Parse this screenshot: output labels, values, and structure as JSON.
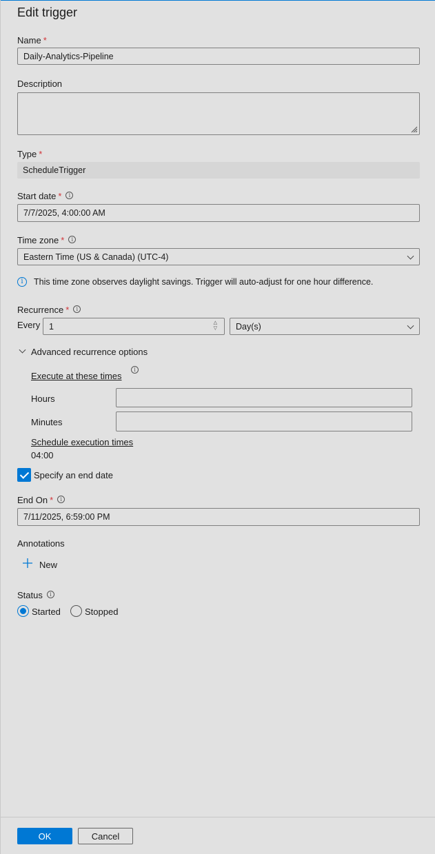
{
  "title": "Edit trigger",
  "name": {
    "label": "Name",
    "required": "*",
    "value": "Daily-Analytics-Pipeline"
  },
  "description": {
    "label": "Description",
    "value": ""
  },
  "type": {
    "label": "Type",
    "required": "*",
    "value": "ScheduleTrigger"
  },
  "start_date": {
    "label": "Start date",
    "required": "*",
    "value": "7/7/2025, 4:00:00 AM"
  },
  "time_zone": {
    "label": "Time zone",
    "required": "*",
    "value": "Eastern Time (US & Canada) (UTC-4)",
    "note": "This time zone observes daylight savings. Trigger will auto-adjust for one hour difference."
  },
  "recurrence": {
    "label": "Recurrence",
    "required": "*",
    "every_label": "Every",
    "interval": "1",
    "unit": "Day(s)"
  },
  "advanced": {
    "label": "Advanced recurrence options",
    "execute_label": "Execute at these times",
    "hours_label": "Hours",
    "hours_value": "",
    "minutes_label": "Minutes",
    "minutes_value": "",
    "schedule_label": "Schedule execution times",
    "schedule_value": "04:00"
  },
  "end_date_toggle": {
    "label": "Specify an end date",
    "checked": true
  },
  "end_on": {
    "label": "End On",
    "required": "*",
    "value": "7/11/2025, 6:59:00 PM"
  },
  "annotations": {
    "label": "Annotations",
    "new_label": "New"
  },
  "status": {
    "label": "Status",
    "options": [
      "Started",
      "Stopped"
    ],
    "selected": "Started"
  },
  "footer": {
    "ok_label": "OK",
    "cancel_label": "Cancel"
  },
  "colors": {
    "accent": "#0078d4",
    "required": "#d13438",
    "background": "#e1e1e1"
  }
}
